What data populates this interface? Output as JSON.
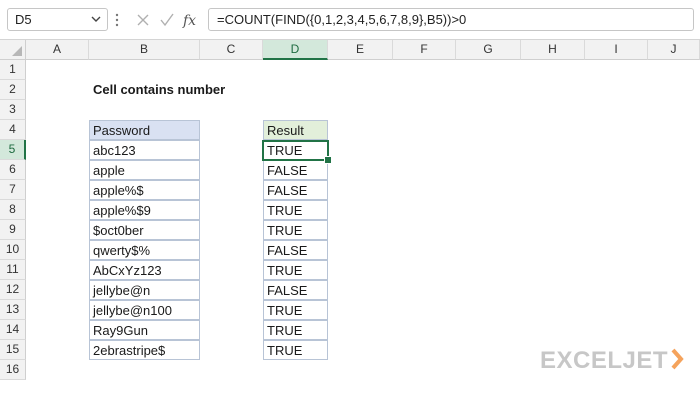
{
  "formula_bar": {
    "name_box": "D5",
    "formula": "=COUNT(FIND({0,1,2,3,4,5,6,7,8,9},B5))>0",
    "fx_label": "fx"
  },
  "columns": [
    "A",
    "B",
    "C",
    "D",
    "E",
    "F",
    "G",
    "H",
    "I",
    "J"
  ],
  "rows": [
    "1",
    "2",
    "3",
    "4",
    "5",
    "6",
    "7",
    "8",
    "9",
    "10",
    "11",
    "12",
    "13",
    "14",
    "15",
    "16"
  ],
  "sheet": {
    "title": "Cell contains number",
    "password_header": "Password",
    "result_header": "Result",
    "passwords": [
      "abc123",
      "apple",
      "apple%$",
      "apple%$9",
      "$oct0ber",
      "qwerty$%",
      "AbCxYz123",
      "jellybe@n",
      "jellybe@n100",
      "Ray9Gun",
      "2ebrastripe$"
    ],
    "results": [
      "TRUE",
      "FALSE",
      "FALSE",
      "TRUE",
      "TRUE",
      "FALSE",
      "TRUE",
      "FALSE",
      "TRUE",
      "TRUE",
      "TRUE"
    ]
  },
  "selection": {
    "column": "D",
    "row": "5"
  },
  "colors": {
    "excel_green": "#217346",
    "header_blue": "#d9e1f2",
    "header_green": "#e2efda",
    "logo_gray": "#c7c7c7",
    "logo_orange": "#f5a35c"
  },
  "brand": {
    "logo_text": "EXCELJET"
  }
}
